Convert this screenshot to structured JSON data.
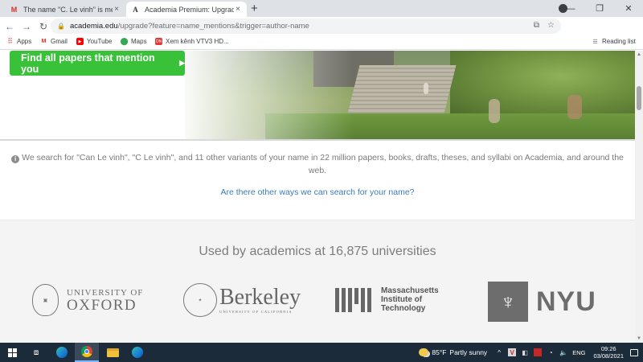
{
  "browser": {
    "tabs": [
      {
        "title": "The name \"C. Le vinh\" is mentioned in...",
        "favicon": "gmail-icon",
        "active": false
      },
      {
        "title": "Academia Premium: Upgrade - Academia...",
        "favicon": "academia-icon",
        "active": true
      }
    ],
    "url_host": "academia.edu",
    "url_path": "/upgrade?feature=name_mentions&trigger=author-name",
    "profile_initial": "C",
    "extension_badge": "4"
  },
  "bookmarks": {
    "items": [
      "Apps",
      "Gmail",
      "YouTube",
      "Maps",
      "Xem kênh VTV3 HD..."
    ],
    "reading_list": "Reading list"
  },
  "hero": {
    "cta_label": "Find all papers that mention you",
    "cta_arrow": "▶"
  },
  "search_info": {
    "text": "We search for \"Can Le vinh\", \"C Le vinh\", and 11 other variants of your name in 22 million papers, books, drafts, theses, and syllabi on Academia, and around the web.",
    "link": "Are there other ways we can search for your name?"
  },
  "universities": {
    "heading": "Used by academics at 16,875 universities",
    "oxford": {
      "line1": "UNIVERSITY OF",
      "line2": "OXFORD"
    },
    "berkeley": {
      "line1": "Berkeley",
      "line2": "UNIVERSITY OF CALIFORNIA"
    },
    "mit": {
      "line1": "Massachusetts",
      "line2": "Institute of",
      "line3": "Technology"
    },
    "nyu": {
      "name": "NYU"
    }
  },
  "taskbar": {
    "weather_temp": "85°F",
    "weather_desc": "Partly sunny",
    "language": "ENG",
    "time": "09:26",
    "date": "03/08/2021"
  },
  "colors": {
    "cta_green": "#3ac13a",
    "link_blue": "#3a7bb8",
    "taskbar_bg": "#1c2b3a"
  }
}
